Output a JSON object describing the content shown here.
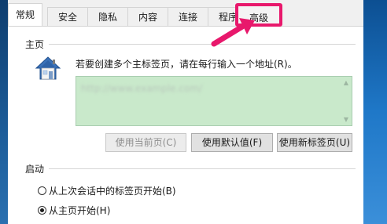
{
  "tabs": [
    {
      "label": "常规",
      "active": true
    },
    {
      "label": "安全"
    },
    {
      "label": "隐私"
    },
    {
      "label": "内容"
    },
    {
      "label": "连接"
    },
    {
      "label": "程序"
    },
    {
      "label": "高级",
      "highlighted": true
    }
  ],
  "home": {
    "section_title": "主页",
    "icon": "house-icon",
    "hint": "若要创建多个主标签页，请在每行输入一个地址(R)。",
    "url_value": "http://www.example.com/",
    "buttons": {
      "use_current": "使用当前页(C)",
      "use_default": "使用默认值(F)",
      "use_new_tab": "使用新标签页(U)"
    }
  },
  "startup": {
    "section_title": "启动",
    "options": [
      {
        "label": "从上次会话中的标签页开始(B)",
        "checked": false
      },
      {
        "label": "从主页开始(H)",
        "checked": true
      }
    ]
  },
  "colors": {
    "highlight": "#e8186c",
    "url_box": "#c9e9cb",
    "desktop": "#1b4a7a"
  }
}
